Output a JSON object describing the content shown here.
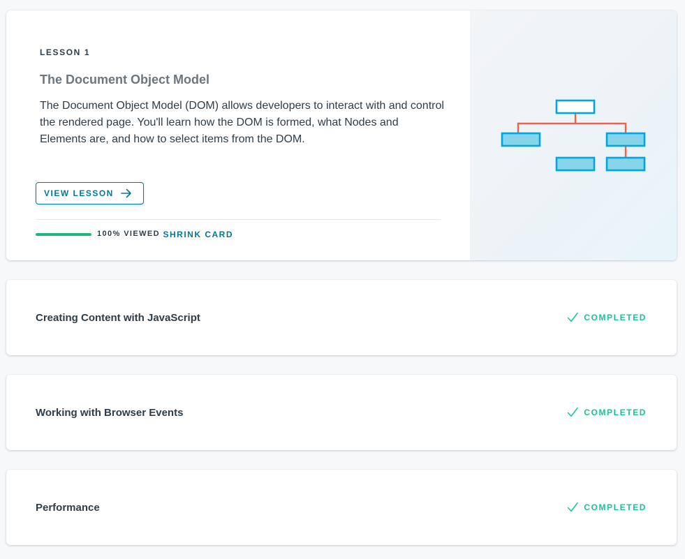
{
  "lesson_card": {
    "eyebrow": "LESSON 1",
    "title": "The Document Object Model",
    "description": "The Document Object Model (DOM) allows developers to interact with and control the rendered page. You'll learn how the DOM is formed, what Nodes and Elements are, and how to select items from the DOM.",
    "view_button_label": "VIEW LESSON",
    "progress_percent": 100,
    "progress_label": "100% VIEWED",
    "shrink_label": "SHRINK CARD",
    "illustration_icon": "dom-tree-diagram-icon",
    "colors": {
      "accent": "#02779c",
      "progress": "#1fb57b",
      "tree_node_fill": "#86d5ea",
      "tree_node_stroke": "#00a6dd",
      "tree_connector": "#f0624a"
    }
  },
  "lessons": [
    {
      "title": "Creating Content with JavaScript",
      "status": "COMPLETED",
      "status_icon": "check-icon"
    },
    {
      "title": "Working with Browser Events",
      "status": "COMPLETED",
      "status_icon": "check-icon"
    },
    {
      "title": "Performance",
      "status": "COMPLETED",
      "status_icon": "check-icon"
    }
  ],
  "status_color": "#15c39a"
}
